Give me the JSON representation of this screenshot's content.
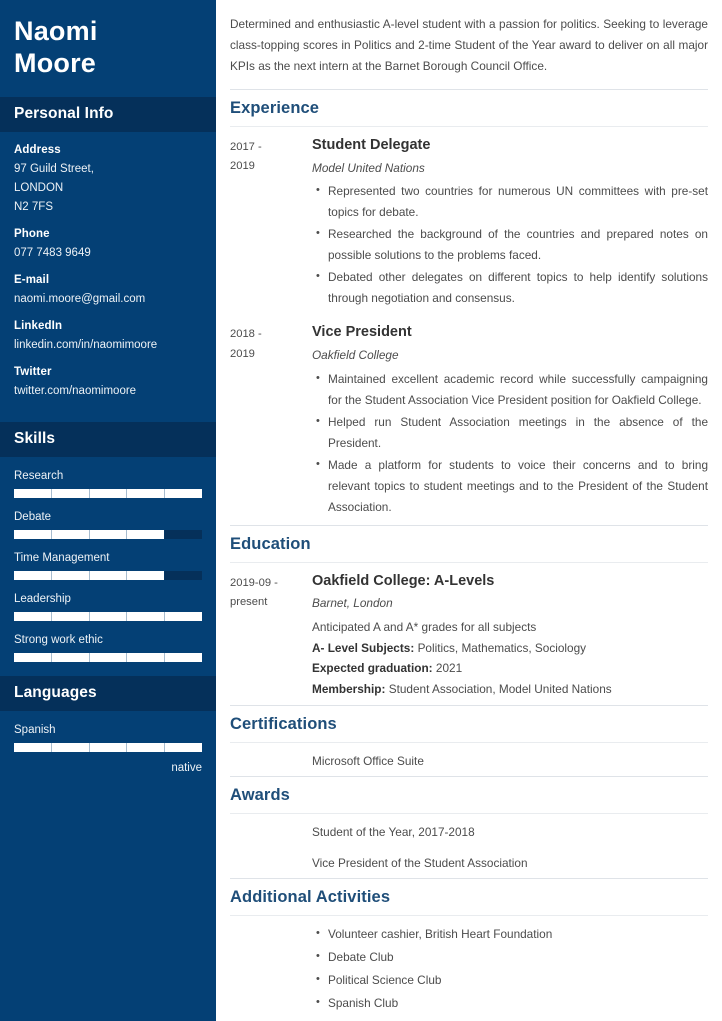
{
  "colors": {
    "sidebar_bg": "#044075",
    "sidebar_band": "#05305a",
    "heading": "#1f4e79",
    "body_text": "#4c4c4c",
    "bar_fill": "#ffffff"
  },
  "sidebar": {
    "name_first": "Naomi",
    "name_last": "Moore",
    "personal_info": {
      "heading": "Personal Info",
      "items": [
        {
          "label": "Address",
          "value": "97 Guild Street,\nLONDON\nN2 7FS"
        },
        {
          "label": "Phone",
          "value": "077 7483 9649"
        },
        {
          "label": "E-mail",
          "value": "naomi.moore@gmail.com"
        },
        {
          "label": "LinkedIn",
          "value": "linkedin.com/in/naomimoore"
        },
        {
          "label": "Twitter",
          "value": "twitter.com/naomimoore"
        }
      ]
    },
    "skills": {
      "heading": "Skills",
      "items": [
        {
          "name": "Research",
          "level": 100
        },
        {
          "name": "Debate",
          "level": 80
        },
        {
          "name": "Time Management",
          "level": 80
        },
        {
          "name": "Leadership",
          "level": 100
        },
        {
          "name": "Strong work ethic",
          "level": 100
        }
      ]
    },
    "languages": {
      "heading": "Languages",
      "items": [
        {
          "name": "Spanish",
          "level": 100,
          "proficiency": "native"
        }
      ]
    }
  },
  "main": {
    "summary": "Determined and enthusiastic A-level student with a passion for politics. Seeking to leverage class-topping scores in Politics and 2-time Student of the Year award to deliver on all major KPIs as the next intern at the Barnet Borough Council Office.",
    "experience": {
      "heading": "Experience",
      "entries": [
        {
          "date_start": "2017 -",
          "date_end": "2019",
          "title": "Student Delegate",
          "subtitle": "Model United Nations",
          "bullets": [
            "Represented two countries for numerous UN committees with pre-set topics for debate.",
            "Researched the background of the countries and prepared notes on possible solutions to the problems faced.",
            "Debated other delegates on different topics to help identify solutions through negotiation and consensus."
          ]
        },
        {
          "date_start": "2018 -",
          "date_end": "2019",
          "title": "Vice President",
          "subtitle": "Oakfield College",
          "bullets": [
            "Maintained excellent academic record while successfully campaigning for the Student Association Vice President position for Oakfield College.",
            "Helped run Student Association meetings in the absence of the President.",
            "Made a platform for students to voice their concerns and to bring relevant topics to student meetings and to the President of the Student Association."
          ]
        }
      ]
    },
    "education": {
      "heading": "Education",
      "entries": [
        {
          "date_start": "2019-09 -",
          "date_end": "present",
          "title": "Oakfield College: A-Levels",
          "subtitle": "Barnet, London",
          "details": [
            {
              "label": "",
              "value": "Anticipated A and A* grades for all subjects"
            },
            {
              "label": "A- Level Subjects:",
              "value": "Politics, Mathematics, Sociology"
            },
            {
              "label": "Expected graduation:",
              "value": "2021"
            },
            {
              "label": "Membership:",
              "value": "Student Association, Model United Nations"
            }
          ]
        }
      ]
    },
    "certifications": {
      "heading": "Certifications",
      "items": [
        "Microsoft Office Suite"
      ]
    },
    "awards": {
      "heading": "Awards",
      "items": [
        "Student of the Year, 2017-2018",
        "Vice President of the Student Association"
      ]
    },
    "activities": {
      "heading": "Additional Activities",
      "items": [
        "Volunteer cashier, British Heart Foundation",
        "Debate Club",
        "Political Science Club",
        "Spanish Club"
      ]
    }
  }
}
